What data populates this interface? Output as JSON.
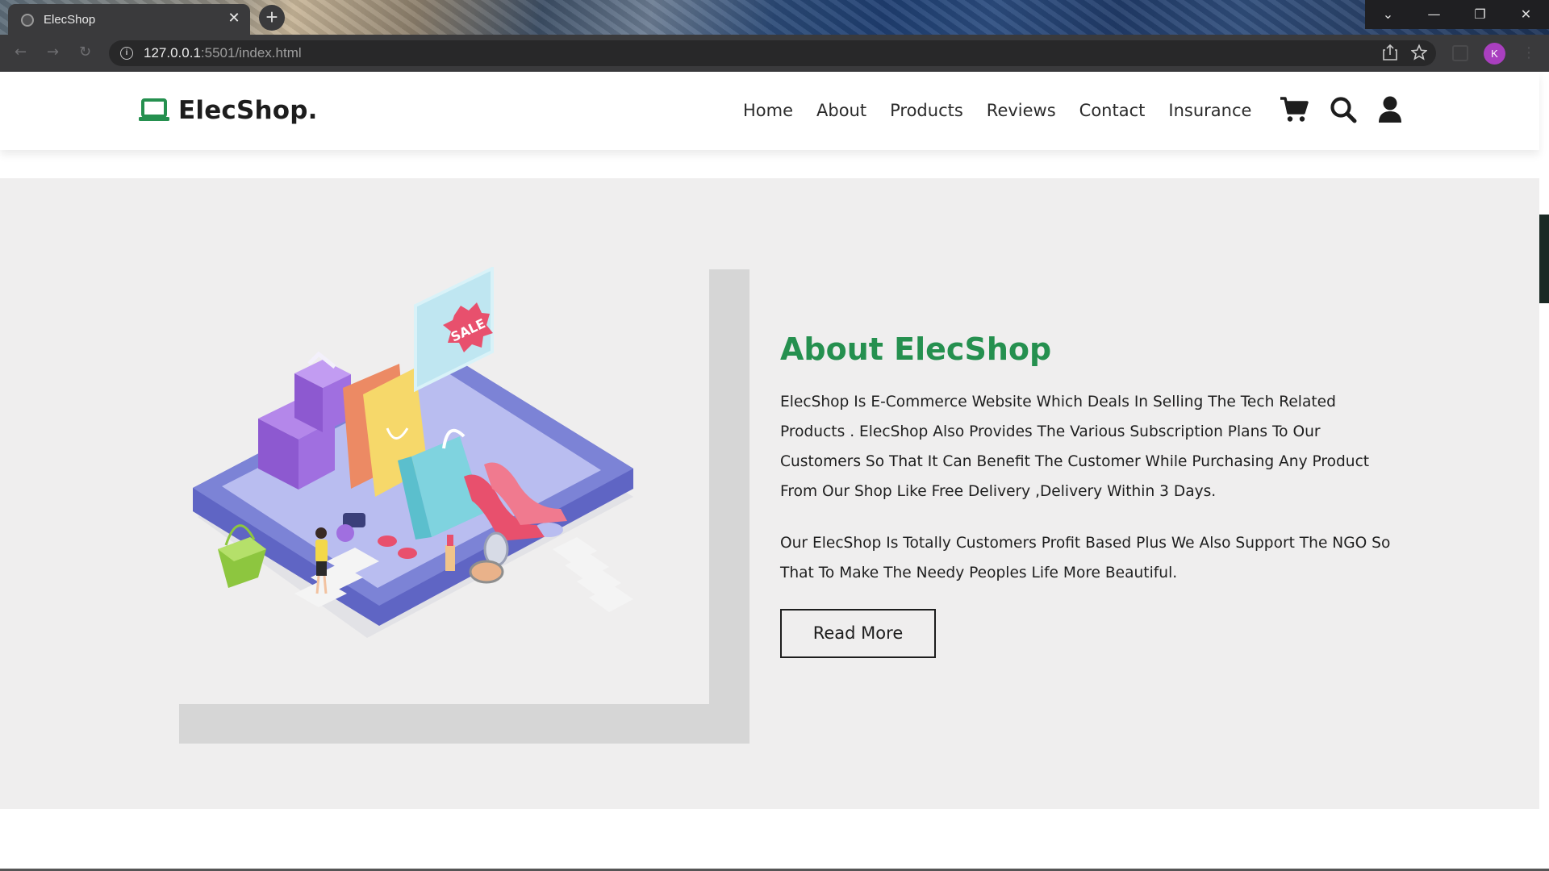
{
  "browser": {
    "tab_title": "ElecShop",
    "tab_close_glyph": "✕",
    "new_tab_glyph": "+",
    "url_host": "127.0.0.1",
    "url_path": ":5501/index.html",
    "profile_initial": "K",
    "window_controls": [
      "⌄",
      "—",
      "❐",
      "✕"
    ]
  },
  "site": {
    "logo_text": "ElecShop.",
    "nav": [
      "Home",
      "About",
      "Products",
      "Reviews",
      "Contact",
      "Insurance"
    ],
    "icons": [
      "shopping-cart-icon",
      "search-icon",
      "user-icon"
    ]
  },
  "about": {
    "title": "About ElecShop",
    "paragraph1": "ElecShop Is E-Commerce Website Which Deals In Selling The Tech Related Products . ElecShop Also Provides The Various Subscription Plans To Our Customers So That It Can Benefit The Customer While Purchasing Any Product From Our Shop Like Free Delivery ,Delivery Within 3 Days.",
    "paragraph2": "Our ElecShop Is Totally Customers Profit Based Plus We Also Support The NGO So That To Make The Needy Peoples Life More Beautiful.",
    "button": "Read More",
    "illustration_sale_text": "SALE"
  },
  "colors": {
    "accent": "#25904f",
    "section_bg": "#efeeee",
    "frame": "#d6d6d6",
    "phone": "#7c83d6"
  }
}
